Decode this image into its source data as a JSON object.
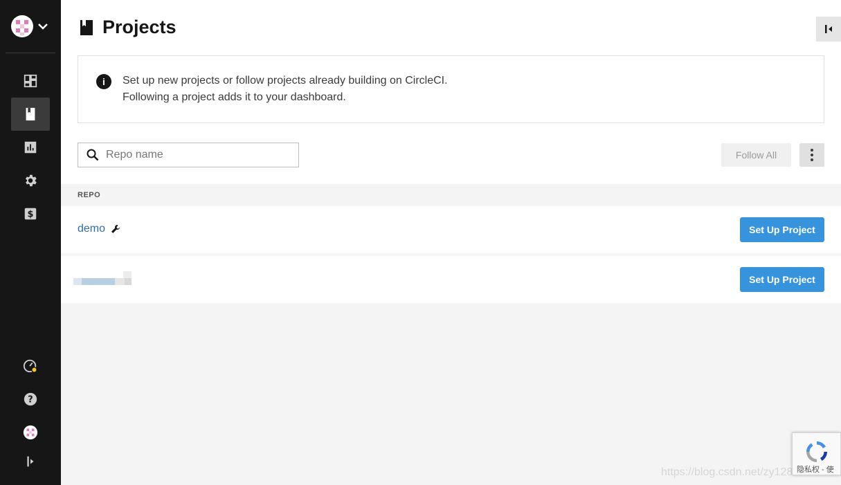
{
  "page": {
    "title": "Projects"
  },
  "info": {
    "line1": "Set up new projects or follow projects already building on CircleCI.",
    "line2": "Following a project adds it to your dashboard."
  },
  "search": {
    "placeholder": "Repo name",
    "value": ""
  },
  "toolbar": {
    "follow_all_label": "Follow All"
  },
  "table": {
    "column_header": "REPO",
    "rows": [
      {
        "name": "demo",
        "action_label": "Set Up Project"
      },
      {
        "name": "",
        "action_label": "Set Up Project"
      }
    ]
  },
  "sidebar": {
    "nav": [
      {
        "id": "dashboard",
        "icon": "dashboard-icon"
      },
      {
        "id": "projects",
        "icon": "book-icon",
        "active": true
      },
      {
        "id": "insights",
        "icon": "bar-chart-icon"
      },
      {
        "id": "settings",
        "icon": "gear-icon"
      },
      {
        "id": "plan",
        "icon": "dollar-icon"
      }
    ],
    "bottom": [
      {
        "id": "status",
        "icon": "speedometer-icon"
      },
      {
        "id": "help",
        "icon": "help-icon"
      },
      {
        "id": "user",
        "icon": "avatar"
      },
      {
        "id": "expand",
        "icon": "expand-icon"
      }
    ]
  },
  "overlay": {
    "watermark": "https://blog.csdn.net/zy1281",
    "recaptcha_text": "隐私权 - 使"
  },
  "colors": {
    "sidebar_bg": "#161616",
    "primary_button": "#3794dc",
    "link": "#2d6ca8",
    "avatar_pink": "#e07ab8"
  }
}
